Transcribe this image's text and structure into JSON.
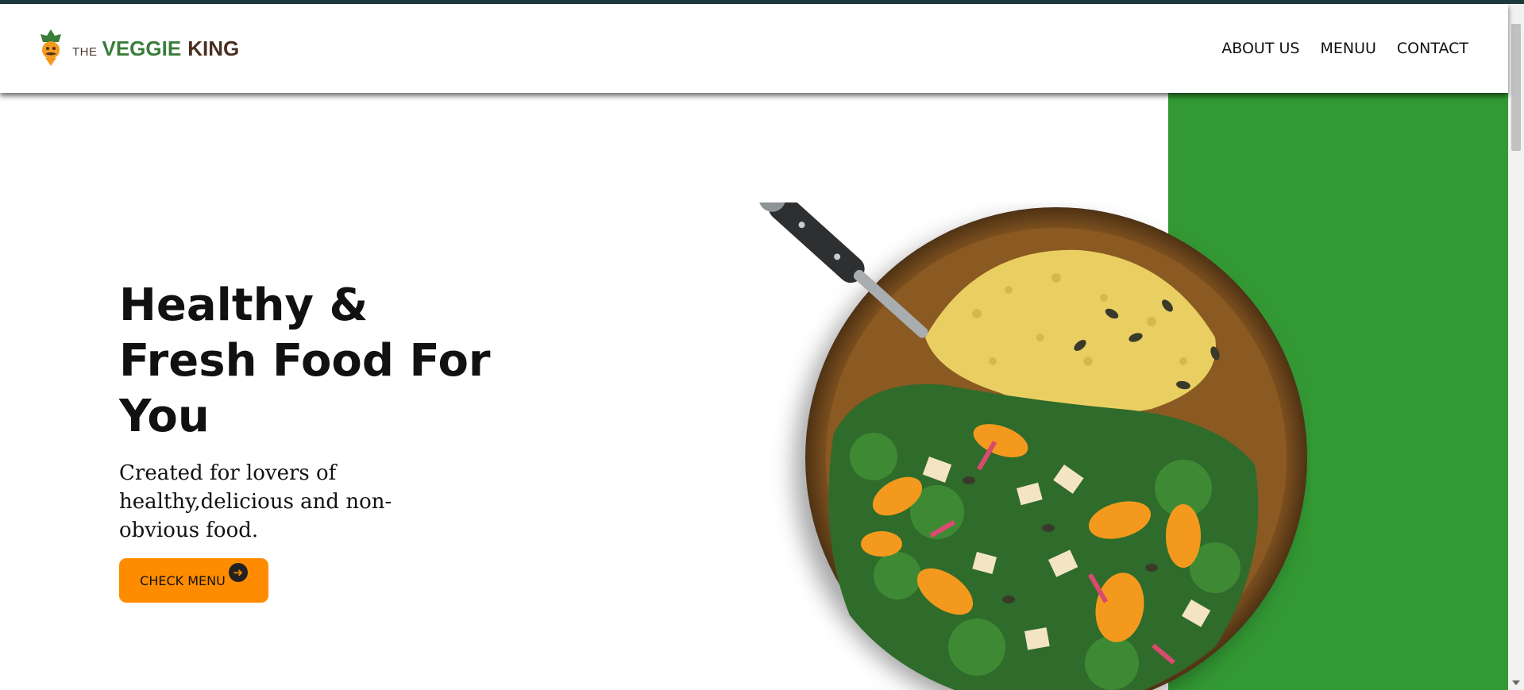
{
  "brand": {
    "the": "THE",
    "veggie": "VEGGIE",
    "king": "KING"
  },
  "nav": {
    "items": [
      {
        "label": "ABOUT US"
      },
      {
        "label": "MENUU"
      },
      {
        "label": "CONTACT"
      }
    ]
  },
  "hero": {
    "title_line1": "Healthy &",
    "title_line2": "Fresh Food For",
    "title_line3": "You",
    "subtitle": "Created for lovers of healthy,delicious and non-obvious food.",
    "cta_label": "CHECK MENU",
    "cta_icon": "arrow-right-circle-icon"
  },
  "colors": {
    "accent_green": "#339933",
    "cta_orange": "#ff8c00",
    "top_line": "#1f3a3c"
  }
}
